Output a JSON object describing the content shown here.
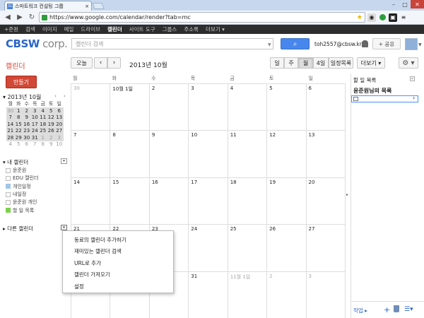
{
  "browser": {
    "tab_title": "스마트워크 컨설팅 그룹",
    "tab_favicon": "31",
    "url": "https://www.google.com/calendar/render?tab=mc",
    "min_label": "–",
    "max_label": "□",
    "close_label": "✕"
  },
  "gbar": {
    "items": [
      "+준원",
      "검색",
      "이미지",
      "메일",
      "드라이브",
      "캘린더",
      "사이트 도구",
      "그룹스",
      "주소록",
      "더보기 ▾"
    ]
  },
  "header": {
    "logo_main": "CBSW",
    "logo_sub": " corp.",
    "search_placeholder": "캘린더 검색",
    "search_dropdown": "▼",
    "search_button_icon": "search-icon",
    "email": "toh2557@cbsw.kr",
    "share_label": "+ 공유",
    "avatar_dropdown": "▼"
  },
  "controls": {
    "calendar_title": "캘린더",
    "today": "오늘",
    "prev": "‹",
    "next": "›",
    "period": "2013년 10월",
    "views": {
      "day": "일",
      "week": "주",
      "month": "월",
      "four_days": "4일",
      "agenda": "일정목록"
    },
    "more": "더보기 ▾",
    "settings": "⚙ ▾"
  },
  "sidebar": {
    "create": "만들기",
    "mini_title": "▾ 2013년 10월",
    "mini_nav": "‹ ›",
    "mini_weekdays": [
      "월",
      "화",
      "수",
      "목",
      "금",
      "토",
      "일"
    ],
    "mini_weeks": [
      [
        "30",
        "1",
        "2",
        "3",
        "4",
        "5",
        "6"
      ],
      [
        "7",
        "8",
        "9",
        "10",
        "11",
        "12",
        "13"
      ],
      [
        "14",
        "15",
        "16",
        "17",
        "18",
        "19",
        "20"
      ],
      [
        "21",
        "22",
        "23",
        "24",
        "25",
        "26",
        "27"
      ],
      [
        "28",
        "29",
        "30",
        "31",
        "1",
        "2",
        "3"
      ],
      [
        "4",
        "5",
        "6",
        "7",
        "8",
        "9",
        "10"
      ]
    ],
    "my_calendars_title": "▾ 내 캘린더",
    "my_calendars_drop": "▾",
    "my_calendars": [
      {
        "label": "윤준원",
        "color": "#ffffff"
      },
      {
        "label": "EDU 캘린더",
        "color": "#ffffff"
      },
      {
        "label": "개인일정",
        "color": "#9fc6e7"
      },
      {
        "label": "내일정",
        "color": "#ffffff"
      },
      {
        "label": "윤준원 개인",
        "color": "#ffffff"
      },
      {
        "label": "할 일 목록",
        "color": "#7bd148"
      }
    ],
    "other_calendars_title": "▸ 다른 캘린더",
    "other_calendars_drop": "▾"
  },
  "grid": {
    "weekdays": [
      "월",
      "화",
      "수",
      "목",
      "금",
      "토",
      "일"
    ],
    "weeks": [
      [
        "30",
        "10월 1일",
        "2",
        "3",
        "4",
        "5",
        "6"
      ],
      [
        "7",
        "8",
        "9",
        "10",
        "11",
        "12",
        "13"
      ],
      [
        "14",
        "15",
        "16",
        "17",
        "18",
        "19",
        "20"
      ],
      [
        "21",
        "22",
        "23",
        "24",
        "25",
        "26",
        "27"
      ],
      [
        "28",
        "29",
        "30",
        "31",
        "11월 1일",
        "2",
        "3"
      ]
    ]
  },
  "popup_menu": {
    "items": [
      "동료의 캘린더 추가하기",
      "재미있는 캘린더 검색",
      "URL로 추가",
      "캘린더 가져오기",
      "설정"
    ]
  },
  "tasks": {
    "panel_title": "할 일 목록",
    "close": "✕",
    "list_title": "윤준원님의 목록",
    "row_arrow": "›",
    "actions": "작업 ▸",
    "add": "+",
    "list_icon": "☰▾"
  },
  "colors": {
    "accent_red": "#d14836",
    "accent_blue": "#4787ed",
    "gbar_bg": "#2d2d2d"
  }
}
